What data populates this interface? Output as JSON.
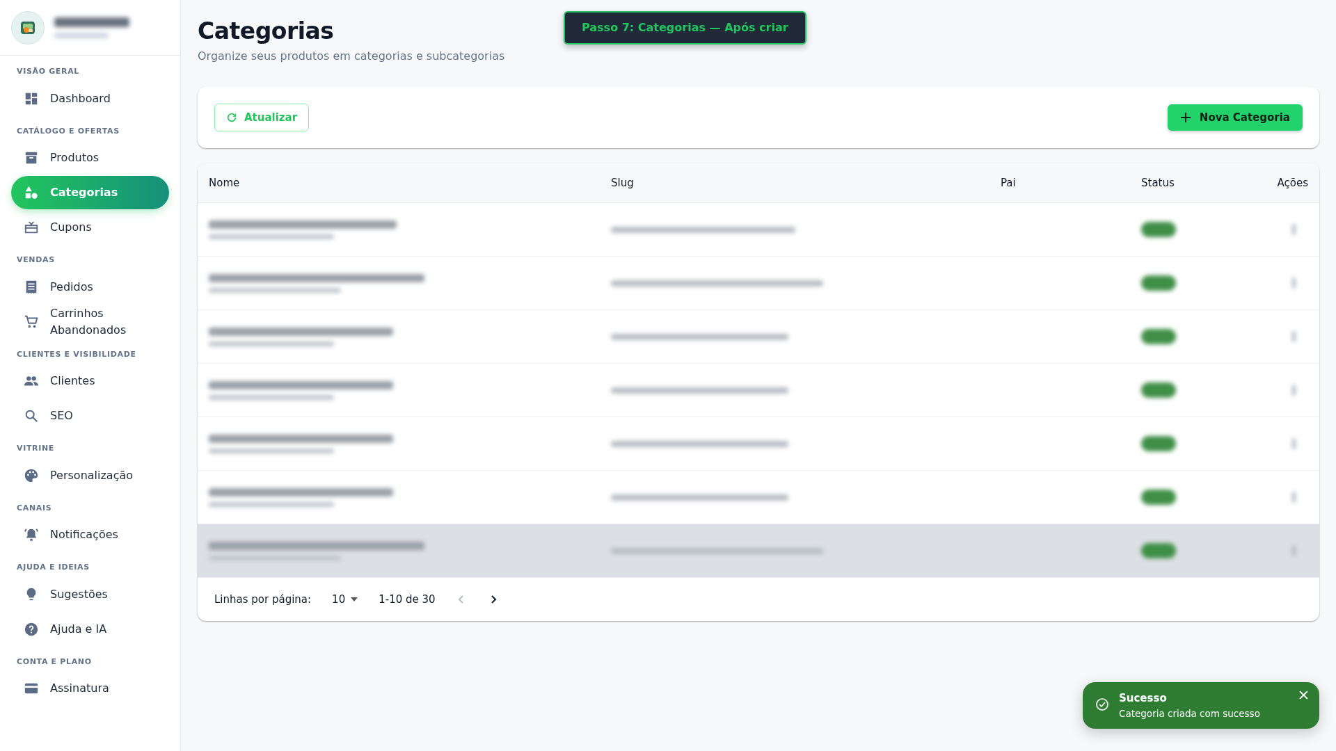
{
  "banner": {
    "text": "Passo 7: Categorias — Após criar"
  },
  "sidebar": {
    "sections": [
      {
        "title": "VISÃO GERAL",
        "items": [
          {
            "label": "Dashboard",
            "selected": false
          }
        ]
      },
      {
        "title": "CATÁLOGO E OFERTAS",
        "items": [
          {
            "label": "Produtos",
            "selected": false
          },
          {
            "label": "Categorias",
            "selected": true
          },
          {
            "label": "Cupons",
            "selected": false
          }
        ]
      },
      {
        "title": "VENDAS",
        "items": [
          {
            "label": "Pedidos",
            "selected": false
          },
          {
            "label": "Carrinhos Abandonados",
            "selected": false
          }
        ]
      },
      {
        "title": "CLIENTES E VISIBILIDADE",
        "items": [
          {
            "label": "Clientes",
            "selected": false
          },
          {
            "label": "SEO",
            "selected": false
          }
        ]
      },
      {
        "title": "VITRINE",
        "items": [
          {
            "label": "Personalização",
            "selected": false
          }
        ]
      },
      {
        "title": "CANAIS",
        "items": [
          {
            "label": "Notificações",
            "selected": false
          }
        ]
      },
      {
        "title": "AJUDA E IDEIAS",
        "items": [
          {
            "label": "Sugestões",
            "selected": false
          },
          {
            "label": "Ajuda e IA",
            "selected": false
          }
        ]
      },
      {
        "title": "CONTA E PLANO",
        "items": [
          {
            "label": "Assinatura",
            "selected": false
          }
        ]
      }
    ]
  },
  "page": {
    "title": "Categorias",
    "subtitle": "Organize seus produtos em categorias e subcategorias"
  },
  "toolbar": {
    "refresh": "Atualizar",
    "create": "Nova Categoria"
  },
  "table": {
    "columns": [
      "Nome",
      "Slug",
      "Pai",
      "Status",
      "Ações"
    ],
    "rows": [
      {
        "hovered": false
      },
      {
        "hovered": false
      },
      {
        "hovered": false
      },
      {
        "hovered": false
      },
      {
        "hovered": false
      },
      {
        "hovered": false
      },
      {
        "hovered": true
      }
    ],
    "pagination": {
      "rows_label": "Linhas por página:",
      "rows_per_page": "10",
      "range": "1-10 de 30",
      "prev_disabled": true,
      "next_disabled": false
    }
  },
  "toast": {
    "title": "Sucesso",
    "message": "Categoria criada com sucesso"
  }
}
